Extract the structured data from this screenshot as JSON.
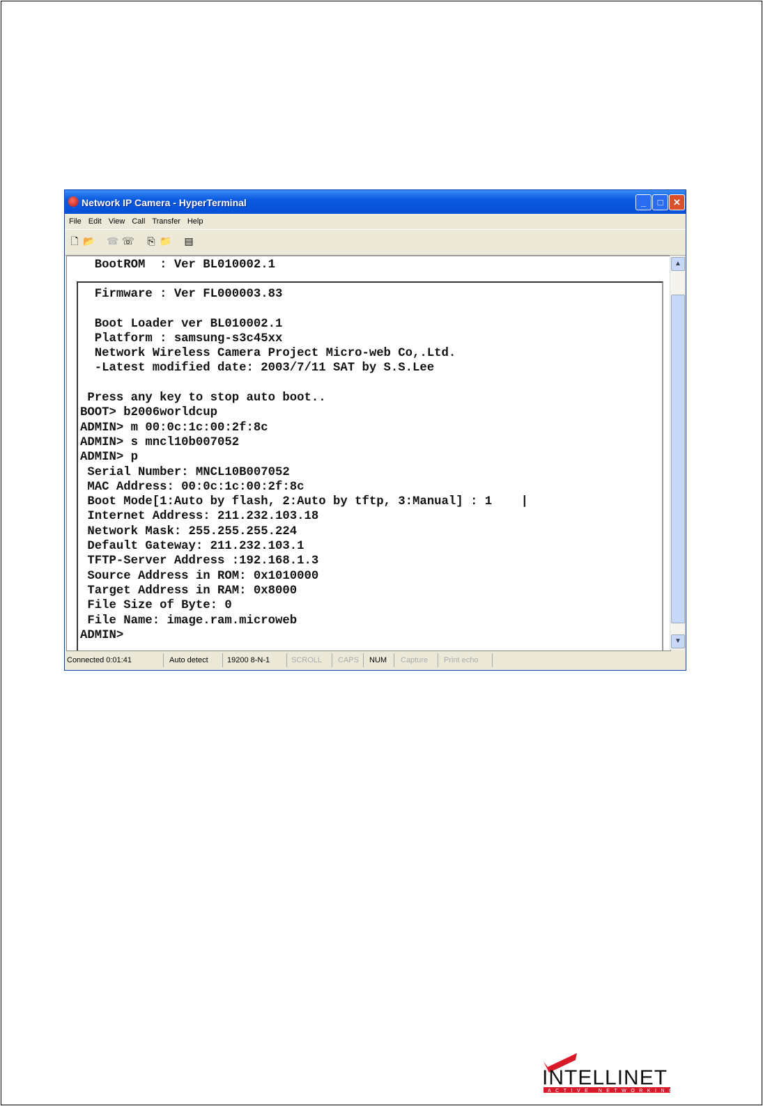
{
  "window": {
    "title": "Network IP Camera - HyperTerminal"
  },
  "menu": [
    "File",
    "Edit",
    "View",
    "Call",
    "Transfer",
    "Help"
  ],
  "terminal": {
    "header_line": "  BootROM  : Ver BL010002.1",
    "lines": [
      "  Firmware : Ver FL000003.83",
      "",
      "  Boot Loader ver BL010002.1",
      "  Platform : samsung-s3c45xx",
      "  Network Wireless Camera Project Micro-web Co,.Ltd.",
      "  -Latest modified date: 2003/7/11 SAT by S.S.Lee",
      "",
      " Press any key to stop auto boot..",
      "BOOT> b2006worldcup",
      "ADMIN> m 00:0c:1c:00:2f:8c",
      "ADMIN> s mncl10b007052",
      "ADMIN> p",
      " Serial Number: MNCL10B007052",
      " MAC Address: 00:0c:1c:00:2f:8c",
      " Boot Mode[1:Auto by flash, 2:Auto by tftp, 3:Manual] : 1    |",
      " Internet Address: 211.232.103.18",
      " Network Mask: 255.255.255.224",
      " Default Gateway: 211.232.103.1",
      " TFTP-Server Address :192.168.1.3",
      " Source Address in ROM: 0x1010000",
      " Target Address in RAM: 0x8000",
      " File Size of Byte: 0",
      " File Name: image.ram.microweb",
      "ADMIN>"
    ]
  },
  "status": {
    "connected": "Connected 0:01:41",
    "detect": "Auto detect",
    "port": "19200 8-N-1",
    "scroll": "SCROLL",
    "caps": "CAPS",
    "num": "NUM",
    "capture": "Capture",
    "print": "Print echo"
  },
  "logo": {
    "name": "INTELLINET",
    "tagline": "ACTIVE NETWORKING",
    "brand_color": "#d7192a"
  }
}
